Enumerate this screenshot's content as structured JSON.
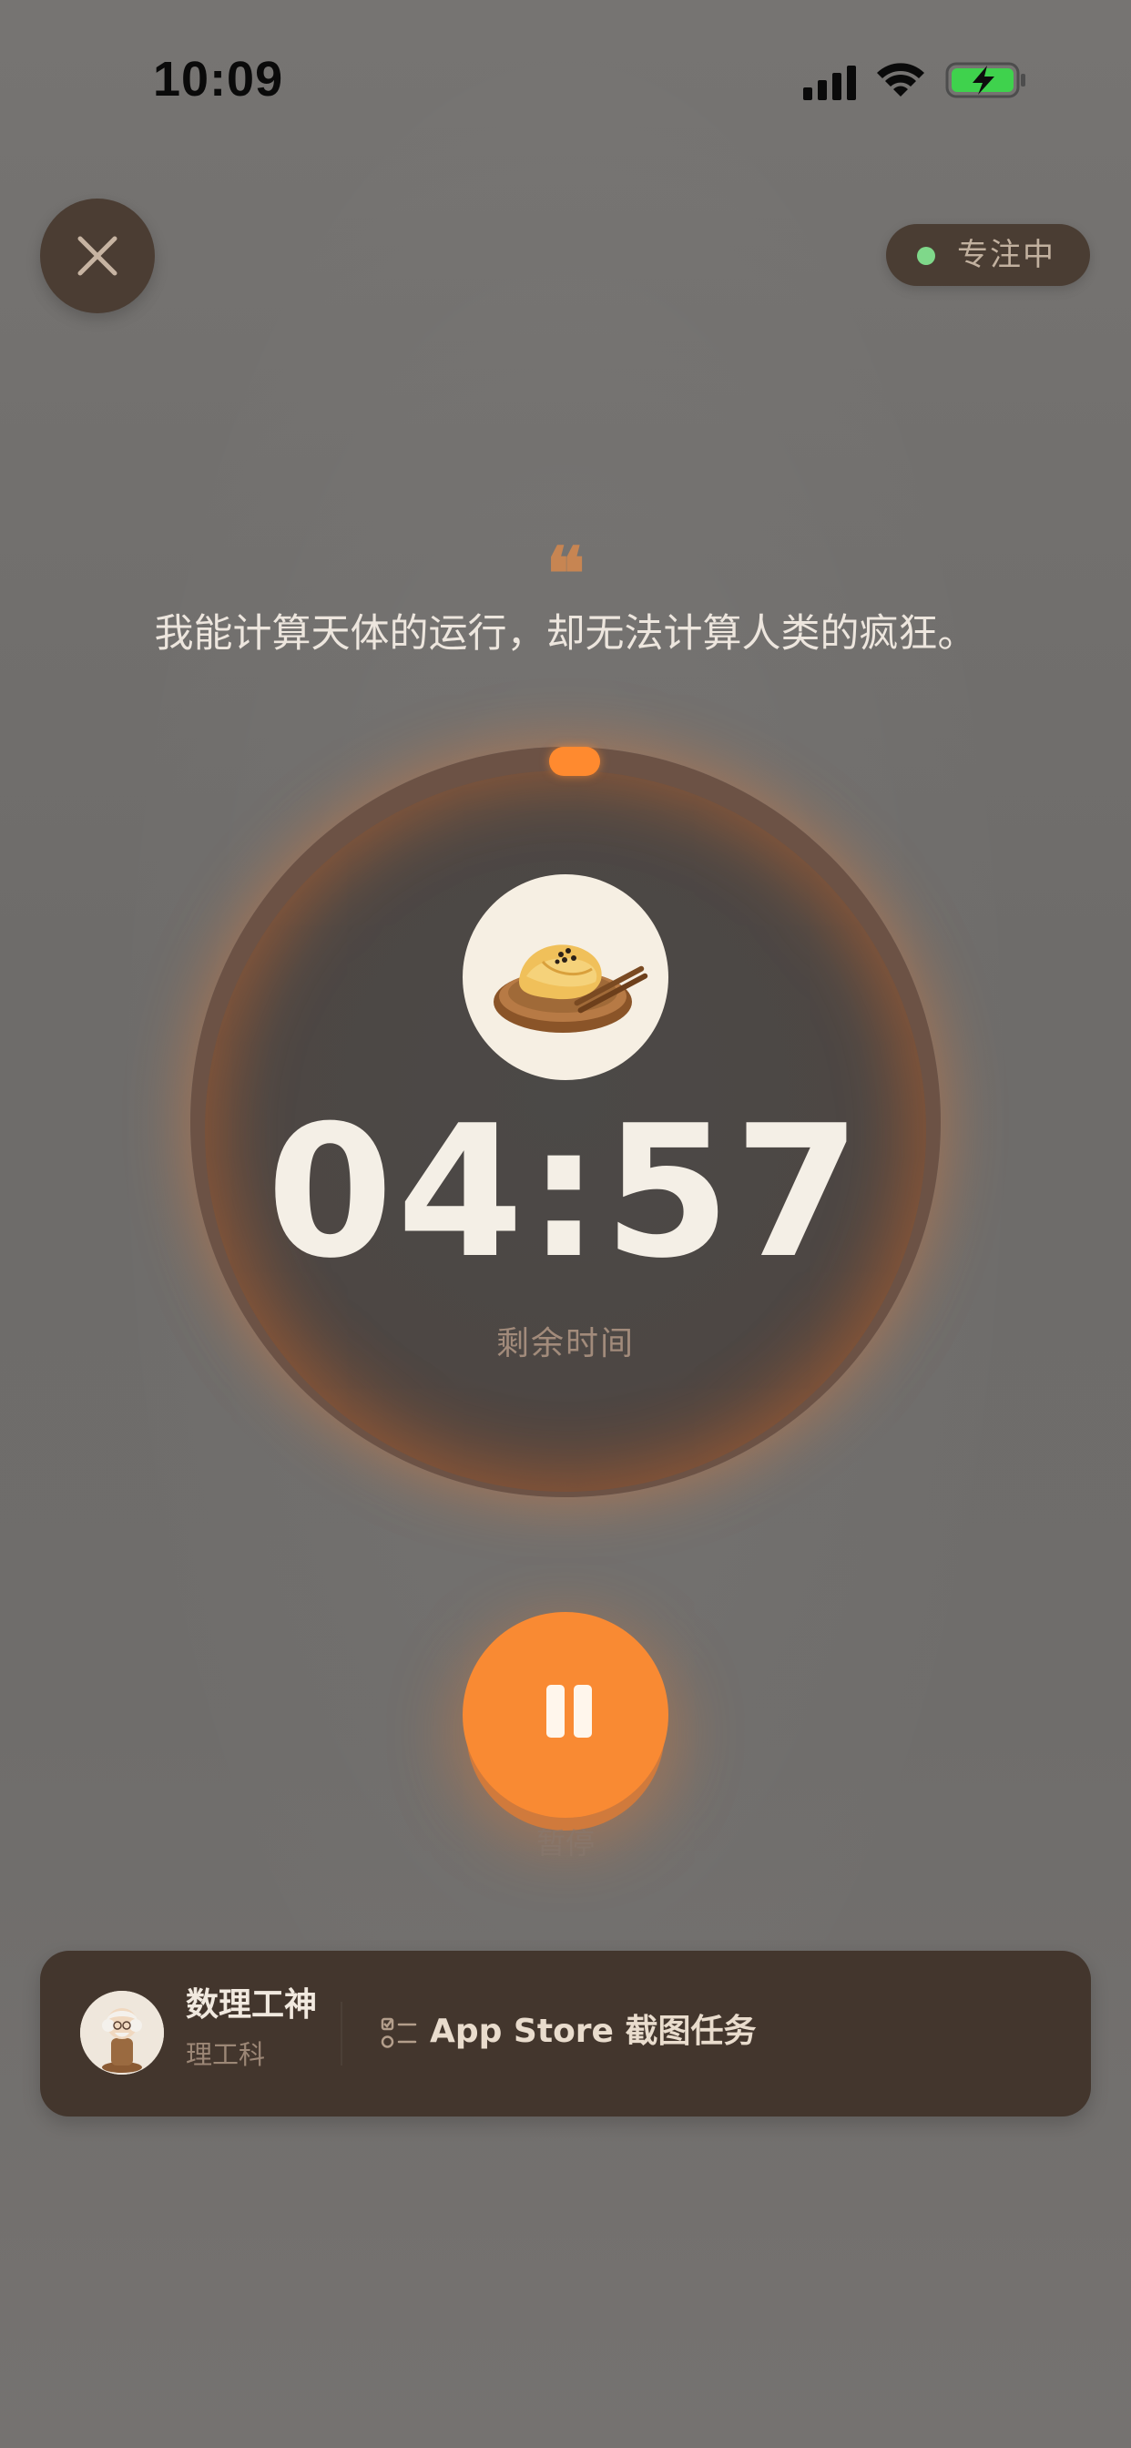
{
  "status_bar": {
    "time": "10:09",
    "icons": [
      "signal-icon",
      "wifi-icon",
      "battery-charging-icon"
    ]
  },
  "header": {
    "close_icon": "close-icon",
    "focus_badge": {
      "label": "专注中",
      "dot_color": "#7fd88a"
    }
  },
  "quote": {
    "mark": "❝",
    "text": "我能计算天体的运行，却无法计算人类的疯狂。"
  },
  "timer": {
    "value": "04:57",
    "label": "剩余时间",
    "food_icon": "egg-roll-plate-icon",
    "accent_color": "#ff8a2f"
  },
  "controls": {
    "pause_icon": "pause-icon",
    "pause_label": "暂停"
  },
  "task_card": {
    "user_name": "数理工神",
    "user_category": "理工科",
    "task_icon": "checklist-icon",
    "task_title": "App Store 截图任务"
  },
  "colors": {
    "background": "#6f6d6b",
    "card": "#43362d",
    "accent": "#f98a33",
    "text_light": "#ede6de"
  }
}
